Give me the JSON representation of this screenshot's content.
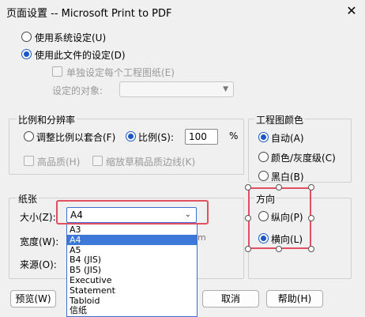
{
  "window": {
    "title": "页面设置 -- Microsoft Print to PDF",
    "close_glyph": "✕"
  },
  "source": {
    "use_system": "使用系统设定(U)",
    "use_file": "使用此文件的设定(D)",
    "separate": "单独设定每个工程图纸(E)",
    "target_label": "设定的对象:"
  },
  "scale": {
    "title": "比例和分辨率",
    "fit": "调整比例以套合(F)",
    "ratio": "比例(S):",
    "ratio_value": "100",
    "percent": "%",
    "high_quality": "高品质(H)",
    "scale_line": "缩放草稿品质边线(K)"
  },
  "color": {
    "title": "工程图颜色",
    "auto": "自动(A)",
    "color_gray": "颜色/灰度级(C)",
    "bw": "黑白(B)"
  },
  "paper": {
    "title": "纸张",
    "size_label": "大小(Z):",
    "size_value": "A4",
    "width_label": "宽度(W):",
    "source_label": "来源(O):",
    "options": [
      "A3",
      "A4",
      "A5",
      "B4 (JIS)",
      "B5 (JIS)",
      "Executive",
      "Statement",
      "Tabloid",
      "信纸"
    ],
    "selected_index": 1,
    "hidden_unit": "m"
  },
  "orientation": {
    "title": "方向",
    "portrait": "纵向(P)",
    "landscape": "横向(L)"
  },
  "buttons": {
    "preview": "预览(W)",
    "cancel": "取消",
    "help": "帮助(H)"
  }
}
